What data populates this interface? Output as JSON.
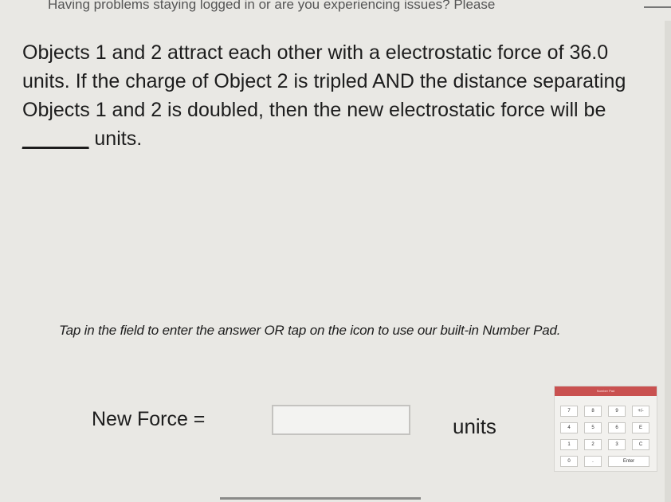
{
  "banner": {
    "text": "Having problems staying logged in or are you experiencing issues? Please"
  },
  "question": {
    "before": "Objects 1 and 2 attract each other with a electrostatic force of 36.0 units. If the charge of Object 2 is tripled AND the distance separating Objects 1 and 2 is doubled, then the new electrostatic force will be ",
    "blank": "______",
    "after": " units."
  },
  "hint": "Tap in the field to enter the answer OR tap on the icon to use our built-in Number Pad.",
  "answer": {
    "label": "New Force =",
    "value": "",
    "units": "units"
  },
  "numpad": {
    "title": "Number Pad",
    "keys": [
      "7",
      "8",
      "9",
      "+/-",
      "4",
      "5",
      "6",
      "E",
      "1",
      "2",
      "3",
      "C",
      "0",
      "."
    ],
    "enter_label": "Enter"
  }
}
